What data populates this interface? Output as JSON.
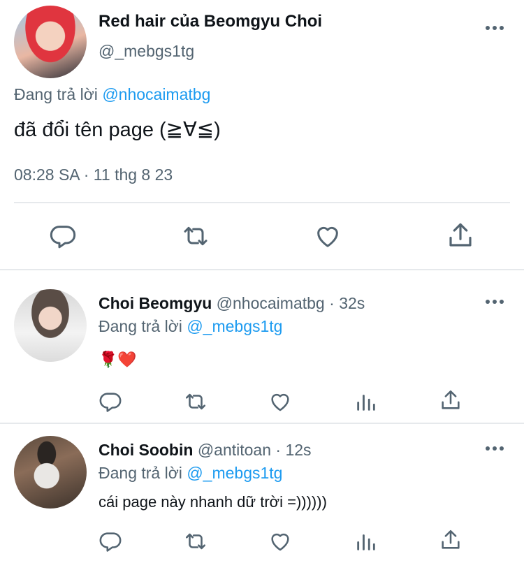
{
  "main_tweet": {
    "display_name": "Red hair của Beomgyu Choi",
    "handle": "@_mebgs1tg",
    "reply_prefix": "Đang trả lời",
    "reply_to": "@nhocaimatbg",
    "text": "đã đổi tên page (≧∀≦)",
    "timestamp": "08:28 SA · 11 thg 8 23",
    "actions": [
      "reply-icon",
      "retweet-icon",
      "like-icon",
      "share-icon"
    ]
  },
  "replies": [
    {
      "display_name": "Choi Beomgyu",
      "handle": "@nhocaimatbg",
      "sep": "·",
      "time": "32s",
      "reply_prefix": "Đang trả lời",
      "reply_to": "@_mebgs1tg",
      "text": "🌹❤️",
      "actions": [
        "reply-icon",
        "retweet-icon",
        "like-icon",
        "analytics-icon",
        "share-icon"
      ]
    },
    {
      "display_name": "Choi Soobin",
      "handle": "@antitoan",
      "sep": "·",
      "time": "12s",
      "reply_prefix": "Đang trả lời",
      "reply_to": "@_mebgs1tg",
      "text": "cái page này nhanh dữ trời =))))))",
      "actions": [
        "reply-icon",
        "retweet-icon",
        "like-icon",
        "analytics-icon",
        "share-icon"
      ]
    }
  ],
  "colors": {
    "text": "#0f1419",
    "secondary": "#536471",
    "link": "#1d9bf0",
    "divider": "#e6e9ec"
  }
}
